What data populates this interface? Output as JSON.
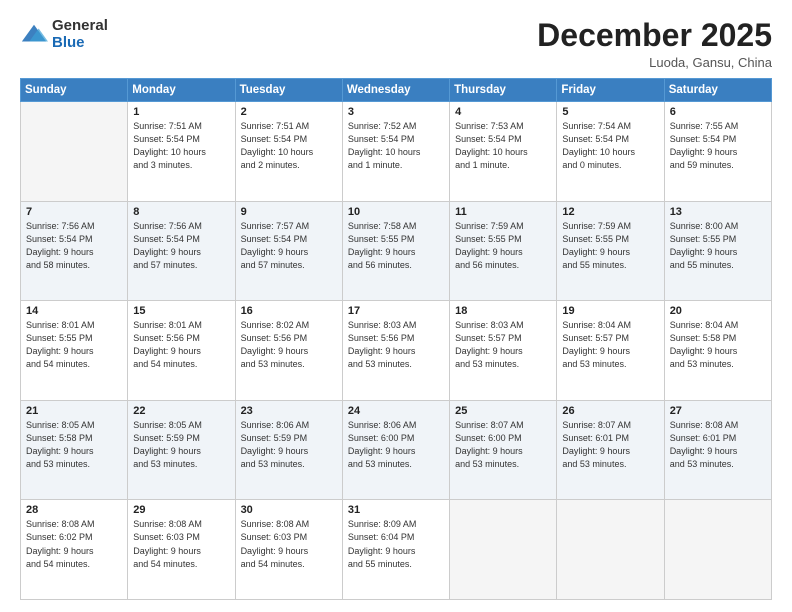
{
  "logo": {
    "general": "General",
    "blue": "Blue"
  },
  "header": {
    "month": "December 2025",
    "location": "Luoda, Gansu, China"
  },
  "days_of_week": [
    "Sunday",
    "Monday",
    "Tuesday",
    "Wednesday",
    "Thursday",
    "Friday",
    "Saturday"
  ],
  "weeks": [
    [
      {
        "day": "",
        "info": ""
      },
      {
        "day": "1",
        "info": "Sunrise: 7:51 AM\nSunset: 5:54 PM\nDaylight: 10 hours\nand 3 minutes."
      },
      {
        "day": "2",
        "info": "Sunrise: 7:51 AM\nSunset: 5:54 PM\nDaylight: 10 hours\nand 2 minutes."
      },
      {
        "day": "3",
        "info": "Sunrise: 7:52 AM\nSunset: 5:54 PM\nDaylight: 10 hours\nand 1 minute."
      },
      {
        "day": "4",
        "info": "Sunrise: 7:53 AM\nSunset: 5:54 PM\nDaylight: 10 hours\nand 1 minute."
      },
      {
        "day": "5",
        "info": "Sunrise: 7:54 AM\nSunset: 5:54 PM\nDaylight: 10 hours\nand 0 minutes."
      },
      {
        "day": "6",
        "info": "Sunrise: 7:55 AM\nSunset: 5:54 PM\nDaylight: 9 hours\nand 59 minutes."
      }
    ],
    [
      {
        "day": "7",
        "info": "Sunrise: 7:56 AM\nSunset: 5:54 PM\nDaylight: 9 hours\nand 58 minutes."
      },
      {
        "day": "8",
        "info": "Sunrise: 7:56 AM\nSunset: 5:54 PM\nDaylight: 9 hours\nand 57 minutes."
      },
      {
        "day": "9",
        "info": "Sunrise: 7:57 AM\nSunset: 5:54 PM\nDaylight: 9 hours\nand 57 minutes."
      },
      {
        "day": "10",
        "info": "Sunrise: 7:58 AM\nSunset: 5:55 PM\nDaylight: 9 hours\nand 56 minutes."
      },
      {
        "day": "11",
        "info": "Sunrise: 7:59 AM\nSunset: 5:55 PM\nDaylight: 9 hours\nand 56 minutes."
      },
      {
        "day": "12",
        "info": "Sunrise: 7:59 AM\nSunset: 5:55 PM\nDaylight: 9 hours\nand 55 minutes."
      },
      {
        "day": "13",
        "info": "Sunrise: 8:00 AM\nSunset: 5:55 PM\nDaylight: 9 hours\nand 55 minutes."
      }
    ],
    [
      {
        "day": "14",
        "info": "Sunrise: 8:01 AM\nSunset: 5:55 PM\nDaylight: 9 hours\nand 54 minutes."
      },
      {
        "day": "15",
        "info": "Sunrise: 8:01 AM\nSunset: 5:56 PM\nDaylight: 9 hours\nand 54 minutes."
      },
      {
        "day": "16",
        "info": "Sunrise: 8:02 AM\nSunset: 5:56 PM\nDaylight: 9 hours\nand 53 minutes."
      },
      {
        "day": "17",
        "info": "Sunrise: 8:03 AM\nSunset: 5:56 PM\nDaylight: 9 hours\nand 53 minutes."
      },
      {
        "day": "18",
        "info": "Sunrise: 8:03 AM\nSunset: 5:57 PM\nDaylight: 9 hours\nand 53 minutes."
      },
      {
        "day": "19",
        "info": "Sunrise: 8:04 AM\nSunset: 5:57 PM\nDaylight: 9 hours\nand 53 minutes."
      },
      {
        "day": "20",
        "info": "Sunrise: 8:04 AM\nSunset: 5:58 PM\nDaylight: 9 hours\nand 53 minutes."
      }
    ],
    [
      {
        "day": "21",
        "info": "Sunrise: 8:05 AM\nSunset: 5:58 PM\nDaylight: 9 hours\nand 53 minutes."
      },
      {
        "day": "22",
        "info": "Sunrise: 8:05 AM\nSunset: 5:59 PM\nDaylight: 9 hours\nand 53 minutes."
      },
      {
        "day": "23",
        "info": "Sunrise: 8:06 AM\nSunset: 5:59 PM\nDaylight: 9 hours\nand 53 minutes."
      },
      {
        "day": "24",
        "info": "Sunrise: 8:06 AM\nSunset: 6:00 PM\nDaylight: 9 hours\nand 53 minutes."
      },
      {
        "day": "25",
        "info": "Sunrise: 8:07 AM\nSunset: 6:00 PM\nDaylight: 9 hours\nand 53 minutes."
      },
      {
        "day": "26",
        "info": "Sunrise: 8:07 AM\nSunset: 6:01 PM\nDaylight: 9 hours\nand 53 minutes."
      },
      {
        "day": "27",
        "info": "Sunrise: 8:08 AM\nSunset: 6:01 PM\nDaylight: 9 hours\nand 53 minutes."
      }
    ],
    [
      {
        "day": "28",
        "info": "Sunrise: 8:08 AM\nSunset: 6:02 PM\nDaylight: 9 hours\nand 54 minutes."
      },
      {
        "day": "29",
        "info": "Sunrise: 8:08 AM\nSunset: 6:03 PM\nDaylight: 9 hours\nand 54 minutes."
      },
      {
        "day": "30",
        "info": "Sunrise: 8:08 AM\nSunset: 6:03 PM\nDaylight: 9 hours\nand 54 minutes."
      },
      {
        "day": "31",
        "info": "Sunrise: 8:09 AM\nSunset: 6:04 PM\nDaylight: 9 hours\nand 55 minutes."
      },
      {
        "day": "",
        "info": ""
      },
      {
        "day": "",
        "info": ""
      },
      {
        "day": "",
        "info": ""
      }
    ]
  ]
}
